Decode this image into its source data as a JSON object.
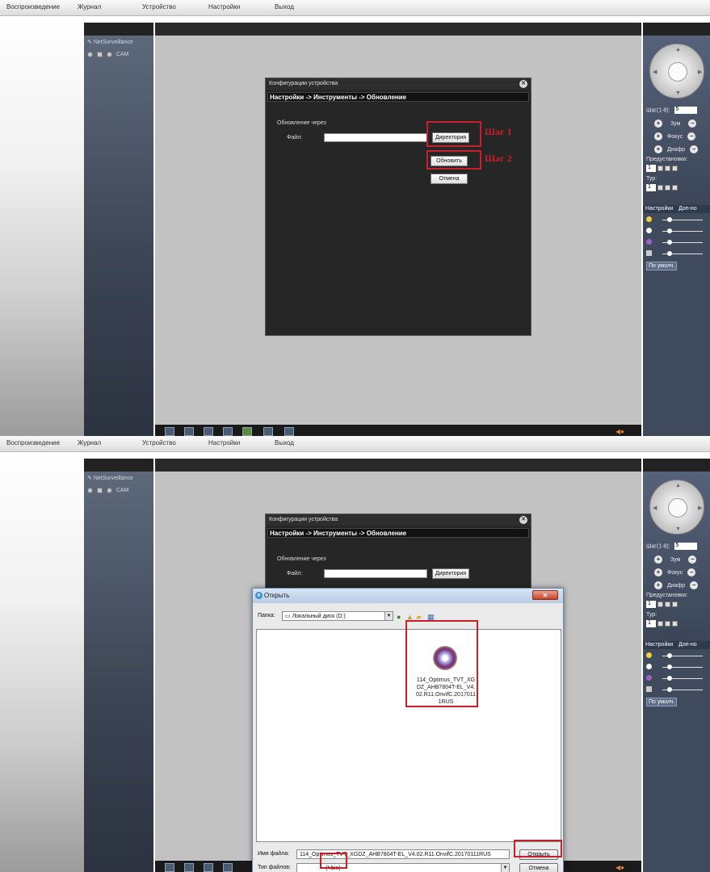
{
  "menu": [
    "Воспроизведение",
    "Журнал",
    "Устройство",
    "Настройки",
    "Выход"
  ],
  "tree": {
    "node_label": "NetSurveillance",
    "cam_label": "CAM"
  },
  "ptz": {
    "step_label": "Шаг(1-8):",
    "step_value": "5",
    "zoom_label": "Зум",
    "focus_label": "Фокус",
    "iris_label": "Диафр",
    "presets_label": "Предустановки:",
    "preset_value": "1",
    "tour_label": "Тур:",
    "tour_value": "1",
    "tab_settings": "Настройки",
    "tab_extra": "Доп-но",
    "default_button": "По умолч."
  },
  "dialog": {
    "title": "Конфигурации устройства",
    "breadcrumb": "Настройки -> Инструменты -> Обновление",
    "update_via_label": "Обновление через",
    "file_label": "Файл:",
    "browse_button": "Директория",
    "update_button": "Обновить",
    "cancel_button": "Отмена"
  },
  "steps": {
    "step1": "Шаг 1",
    "step2": "Шаг 2"
  },
  "open_dialog": {
    "title": "Открыть",
    "folder_label": "Папка:",
    "folder_value": "Локальный диск (D:)",
    "file_item": "114_Optimus_TVT_XGDZ_AHB7804T-EL_V4.02.R11.OnvifC.20170111RUS",
    "filename_label": "Имя файла:",
    "filename_value": "114_Optimus_TVT_XGDZ_AHB7804T-EL_V4.02.R11.OnvifC.20170111RUS",
    "filetype_label": "Тип файлов:",
    "filetype_value": "(*.bin)",
    "open_button": "Открыть",
    "cancel_button": "Отмена"
  }
}
